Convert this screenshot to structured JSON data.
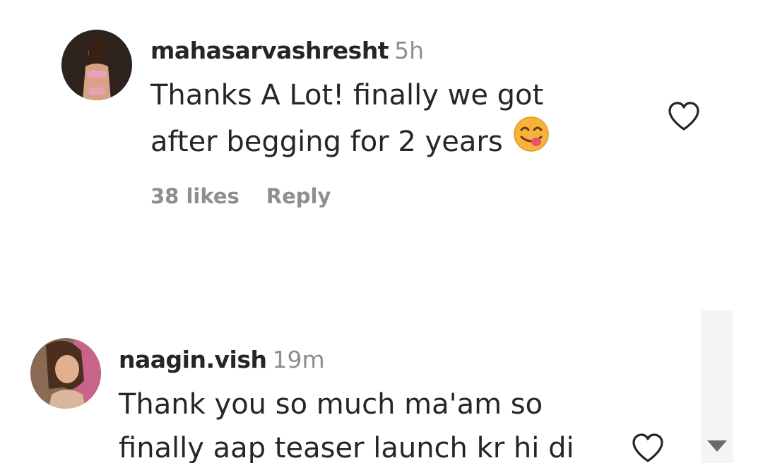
{
  "comments": [
    {
      "username": "mahasarvashresht",
      "time": "5h",
      "text_lines": [
        "Thanks A Lot! finally we got",
        "after begging for 2 years"
      ],
      "emoji": "savoring-food-face-emoji",
      "likes": "38 likes",
      "reply": "Reply"
    },
    {
      "username": "naagin.vish",
      "time": "19m",
      "text_lines": [
        "Thank you so much ma'am so",
        "finally aap teaser launch kr hi di"
      ]
    }
  ],
  "colors": {
    "text": "#262626",
    "muted": "#8e8e8e",
    "emoji_face": "#f7b23b",
    "emoji_tongue": "#e8506b"
  },
  "icons": [
    "heart-outline-icon",
    "scroll-down-arrow-icon"
  ]
}
